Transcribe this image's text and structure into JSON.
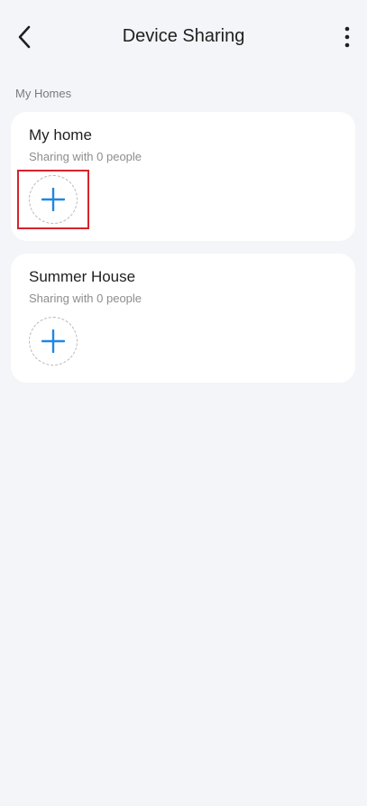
{
  "header": {
    "title": "Device Sharing",
    "back_icon": "chevron-left-icon",
    "more_icon": "more-vertical-icon"
  },
  "section": {
    "label": "My Homes"
  },
  "homes": [
    {
      "name": "My home",
      "sharing": "Sharing with 0 people",
      "add_icon": "plus-icon",
      "highlighted": true
    },
    {
      "name": "Summer House",
      "sharing": "Sharing with 0 people",
      "add_icon": "plus-icon",
      "highlighted": false
    }
  ],
  "colors": {
    "background": "#f4f5f9",
    "card": "#ffffff",
    "accent": "#1e88e5",
    "highlight": "#d6242c",
    "subtitle": "#8d8d8d"
  }
}
